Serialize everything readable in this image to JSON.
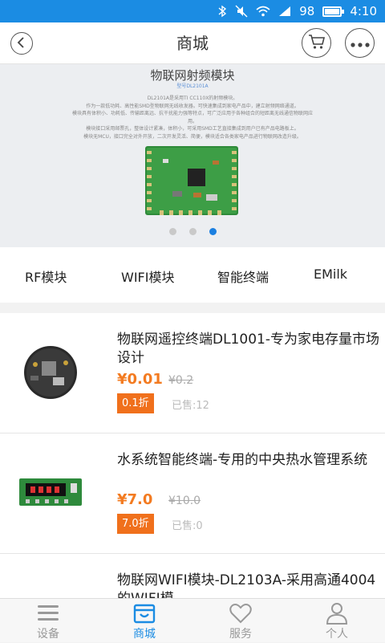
{
  "status_bar": {
    "battery": "98",
    "time": "4:10",
    "battery_level": 0.98
  },
  "header": {
    "title": "商城",
    "icons": [
      "back-icon",
      "cart-icon",
      "more-icon"
    ]
  },
  "banner": {
    "title": "物联网射频模块",
    "subtitle": "型号DL2101A",
    "description": [
      "DL2101A是采用TI CC110X的射频模块。",
      "作为一款低功耗、高性能SMD型物联网无线收发器。可快速集成到家电产品中，建立射频网络通道。",
      "模块具有体积小、功耗低、传输距离远、抗干扰能力强等特点，可广泛应用于各种组合的短距离无线通信物联网应用。",
      "模块接口采用邮票孔，整体设计紧凑，体积小，可采用SMD工艺直接集成到用户已有产品电路板上。",
      "模块无MCU，接口完全对外开放，二次开发灵活、简便，模块适合各类家电产品进行物联网改造升级。"
    ],
    "slides": 3,
    "active_slide": 3
  },
  "categories": [
    "RF模块",
    "WIFI模块",
    "智能终端",
    "EMilk"
  ],
  "products": [
    {
      "name": "物联网遥控终端DL1001-专为家电存量市场设计",
      "price": "¥0.01",
      "old_price": "¥0.2",
      "discount": "0.1折",
      "sold": "已售:12"
    },
    {
      "name": "水系统智能终端-专用的中央热水管理系统",
      "price": "¥7.0",
      "old_price": "¥10.0",
      "discount": "7.0折",
      "sold": "已售:0"
    },
    {
      "name": "物联网WIFI模块-DL2103A-采用高通4004的WIFI模",
      "price": "",
      "old_price": "",
      "discount": "",
      "sold": ""
    }
  ],
  "tabs": [
    {
      "label": "设备",
      "icon": "menu-icon"
    },
    {
      "label": "商城",
      "icon": "store-icon",
      "active": true
    },
    {
      "label": "服务",
      "icon": "heart-icon"
    },
    {
      "label": "个人",
      "icon": "person-icon"
    }
  ],
  "colors": {
    "accent": "#1b8ce3",
    "price": "#f37b21",
    "discount_bg": "#f0701c"
  }
}
